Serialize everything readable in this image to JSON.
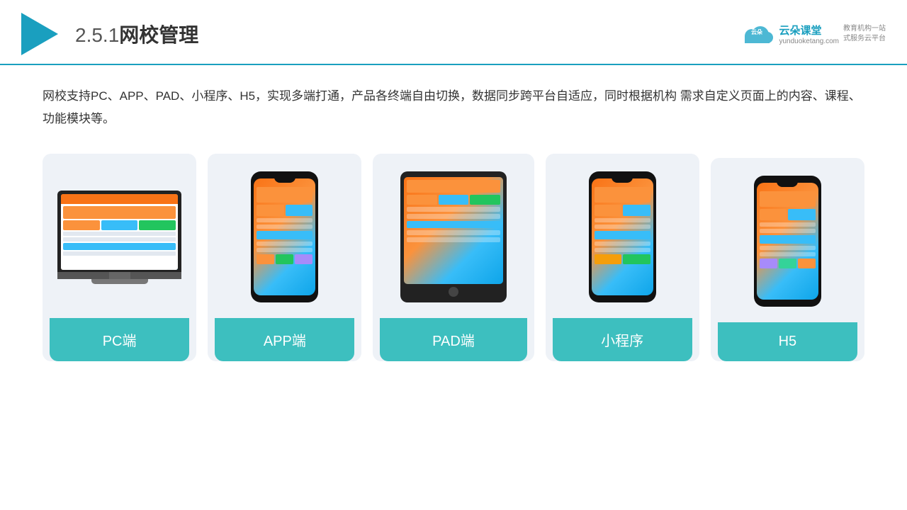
{
  "header": {
    "section_number": "2.5.1",
    "title": "网校管理",
    "brand_name": "云朵课堂",
    "brand_url": "yunduoketang.com",
    "brand_tagline": "教育机构一站\n式服务云平台"
  },
  "description": "网校支持PC、APP、PAD、小程序、H5，实现多端打通，产品各终端自由切换，数据同步跨平台自适应，同时根据机构\n需求自定义页面上的内容、课程、功能模块等。",
  "cards": [
    {
      "id": "pc",
      "label": "PC端"
    },
    {
      "id": "app",
      "label": "APP端"
    },
    {
      "id": "pad",
      "label": "PAD端"
    },
    {
      "id": "miniapp",
      "label": "小程序"
    },
    {
      "id": "h5",
      "label": "H5"
    }
  ],
  "colors": {
    "accent": "#1a9fbf",
    "card_bg": "#eef2f7",
    "card_label_bg": "#3dbfbf",
    "text_primary": "#333333",
    "text_secondary": "#555555"
  }
}
